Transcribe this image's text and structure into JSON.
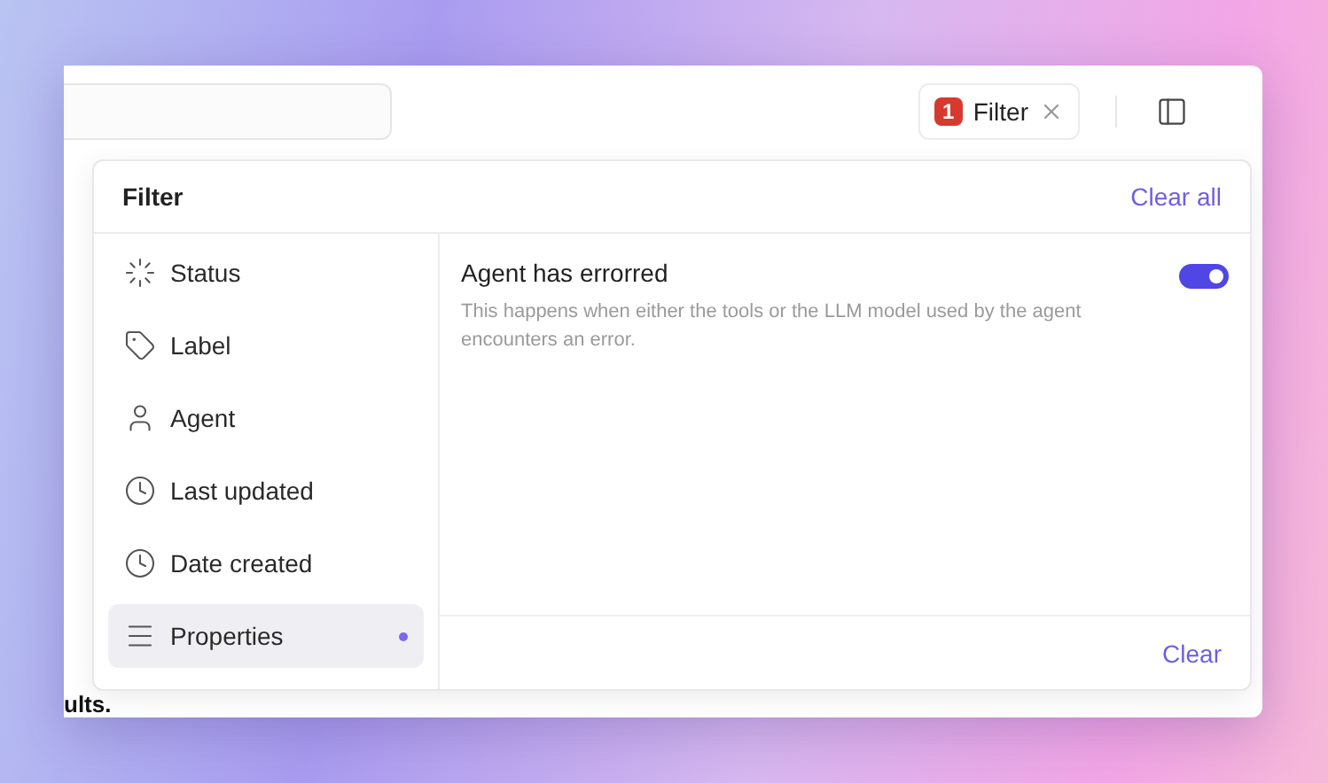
{
  "toolbar": {
    "filter_chip": {
      "count": "1",
      "label": "Filter"
    }
  },
  "popover": {
    "title": "Filter",
    "clear_all": "Clear all",
    "categories": [
      {
        "label": "Status",
        "kind": "loader",
        "selected": false,
        "active": false
      },
      {
        "label": "Label",
        "kind": "tag",
        "selected": false,
        "active": false
      },
      {
        "label": "Agent",
        "kind": "user",
        "selected": false,
        "active": false
      },
      {
        "label": "Last updated",
        "kind": "clock",
        "selected": false,
        "active": false
      },
      {
        "label": "Date created",
        "kind": "clock",
        "selected": false,
        "active": false
      },
      {
        "label": "Properties",
        "kind": "menu",
        "selected": true,
        "active": true
      }
    ],
    "option": {
      "title": "Agent has errorred",
      "description": "This happens when either the tools or the LLM model used by the agent encounters an error.",
      "on": true
    },
    "clear": "Clear"
  },
  "background_text": "ults."
}
